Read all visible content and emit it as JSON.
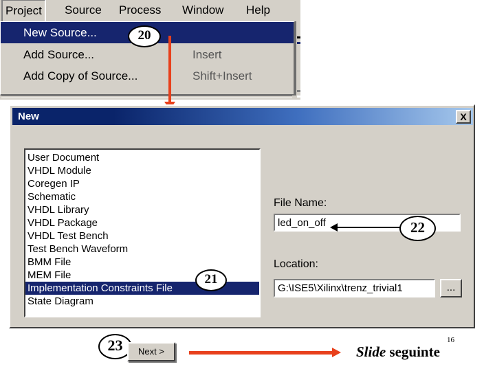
{
  "menu_window": {
    "menubar": [
      {
        "label": "Project",
        "state": "pressed"
      },
      {
        "label": "Source",
        "state": "normal"
      },
      {
        "label": "Process",
        "state": "normal"
      },
      {
        "label": "Window",
        "state": "normal"
      },
      {
        "label": "Help",
        "state": "normal"
      }
    ],
    "dropdown": [
      {
        "label": "New Source...",
        "shortcut": "",
        "selected": true
      },
      {
        "label": "Add Source...",
        "shortcut": "Insert",
        "selected": false
      },
      {
        "label": "Add Copy of Source...",
        "shortcut": "Shift+Insert",
        "selected": false
      }
    ]
  },
  "dialog": {
    "title": "New",
    "close_label": "X",
    "list_items": [
      {
        "label": "User Document",
        "selected": false
      },
      {
        "label": "VHDL Module",
        "selected": false
      },
      {
        "label": "Coregen IP",
        "selected": false
      },
      {
        "label": "Schematic",
        "selected": false
      },
      {
        "label": "VHDL Library",
        "selected": false
      },
      {
        "label": "VHDL Package",
        "selected": false
      },
      {
        "label": "VHDL Test Bench",
        "selected": false
      },
      {
        "label": "Test Bench Waveform",
        "selected": false
      },
      {
        "label": "BMM File",
        "selected": false
      },
      {
        "label": "MEM File",
        "selected": false
      },
      {
        "label": "Implementation Constraints File",
        "selected": true
      },
      {
        "label": "State Diagram",
        "selected": false
      }
    ],
    "file_name_label": "File Name:",
    "file_name_value": "led_on_off",
    "location_label": "Location:",
    "location_value": "G:\\ISE5\\Xilinx\\trenz_trivial1",
    "browse_label": "...",
    "next_label": "Next >"
  },
  "callouts": [
    {
      "id": "c20",
      "text": "20"
    },
    {
      "id": "c21",
      "text": "21"
    },
    {
      "id": "c22",
      "text": "22"
    },
    {
      "id": "c23",
      "text": "23"
    }
  ],
  "footer": {
    "slide_italic": "Slide",
    "slide_regular": " seguinte",
    "page_number": "16"
  },
  "colors": {
    "accent_red": "#e8401c",
    "selection_blue": "#16256e",
    "title_blue": "#0a246a",
    "face": "#d4d0c8"
  }
}
